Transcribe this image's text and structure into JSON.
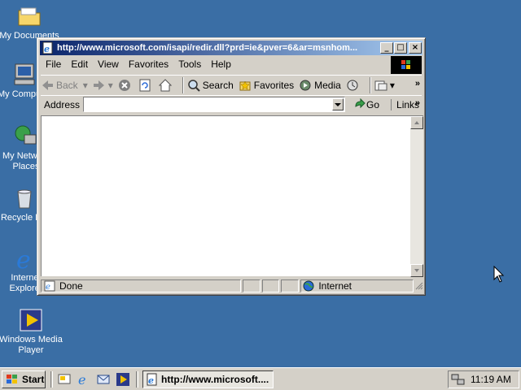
{
  "desktop": {
    "icons": [
      {
        "label": "My Documents"
      },
      {
        "label": "My Computer"
      },
      {
        "label": "My Network Places"
      },
      {
        "label": "Recycle Bin"
      },
      {
        "label": "Internet Explorer"
      },
      {
        "label": "Windows Media Player"
      }
    ]
  },
  "window": {
    "title": "http://www.microsoft.com/isapi/redir.dll?prd=ie&pver=6&ar=msnhom...",
    "menu": [
      "File",
      "Edit",
      "View",
      "Favorites",
      "Tools",
      "Help"
    ],
    "toolbar": {
      "back": "Back",
      "search": "Search",
      "favorites": "Favorites",
      "media": "Media"
    },
    "address": {
      "label": "Address",
      "value": "",
      "go": "Go",
      "links": "Links"
    },
    "status": {
      "text": "Done",
      "zone": "Internet"
    }
  },
  "taskbar": {
    "start": "Start",
    "task": "http://www.microsoft....",
    "clock": "11:19 AM"
  }
}
